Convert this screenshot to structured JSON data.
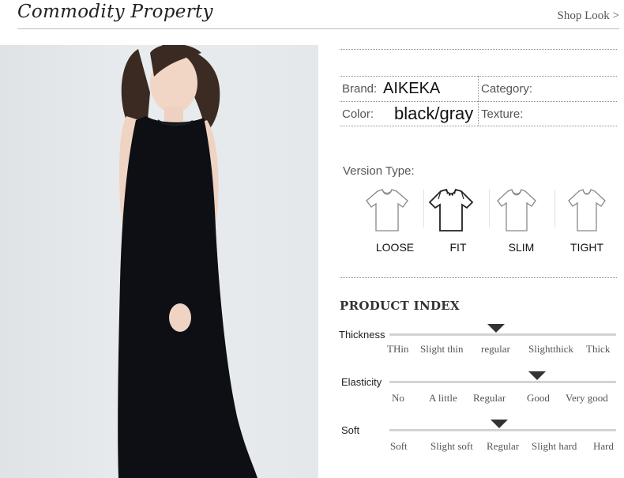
{
  "header": {
    "title": "Commodity Property",
    "shop_look": "Shop Look  >"
  },
  "info": {
    "brand_label": "Brand:",
    "brand_value": "AIKEKA",
    "category_label": "Category:",
    "color_label": "Color:",
    "color_value": "black/gray",
    "texture_label": "Texture:"
  },
  "version": {
    "label": "Version Type:",
    "types": [
      "LOOSE",
      "FIT",
      "SLIM",
      "TIGHT"
    ],
    "selected": "FIT"
  },
  "product_index": {
    "title": "PRODUCT INDEX",
    "thickness": {
      "label": "Thickness",
      "options": [
        "THin",
        "Slight thin",
        "regular",
        "Slightthick",
        "Thick"
      ],
      "selected": "regular"
    },
    "elasticity": {
      "label": "Elasticity",
      "options": [
        "No",
        "A little",
        "Regular",
        "Good",
        "Very good"
      ],
      "selected": "Good"
    },
    "soft": {
      "label": "Soft",
      "options": [
        "Soft",
        "Slight soft",
        "Regular",
        "Slight hard",
        "Hard"
      ],
      "selected": "Regular"
    }
  }
}
